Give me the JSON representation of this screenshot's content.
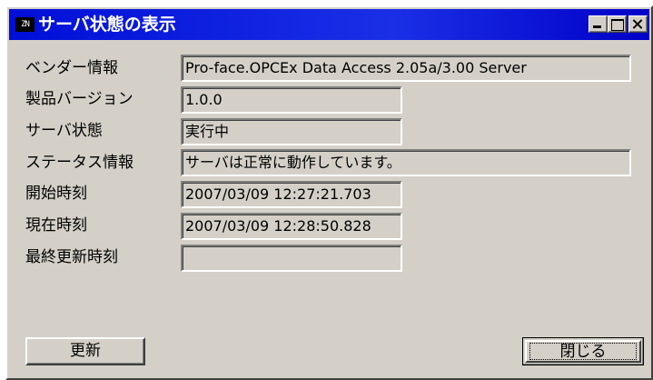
{
  "window": {
    "title": "サーバ状態の表示",
    "icon_text": "ZN",
    "icon_name": "app-icon",
    "title_bar_color": "#0000c8"
  },
  "fields": [
    {
      "label": "ベンダー情報",
      "value": "Pro-face.OPCEx Data Access 2.05a/3.00 Server"
    },
    {
      "label": "製品バージョン",
      "value": "1.0.0"
    },
    {
      "label": "サーバ状態",
      "value": "実行中"
    },
    {
      "label": "ステータス情報",
      "value": "サーバは正常に動作しています。"
    },
    {
      "label": "開始時刻",
      "value": "2007/03/09 12:27:21.703"
    },
    {
      "label": "現在時刻",
      "value": "2007/03/09 12:28:50.828"
    },
    {
      "label": "最終更新時刻",
      "value": ""
    }
  ],
  "buttons": {
    "refresh": "更新",
    "close": "閉じる"
  }
}
